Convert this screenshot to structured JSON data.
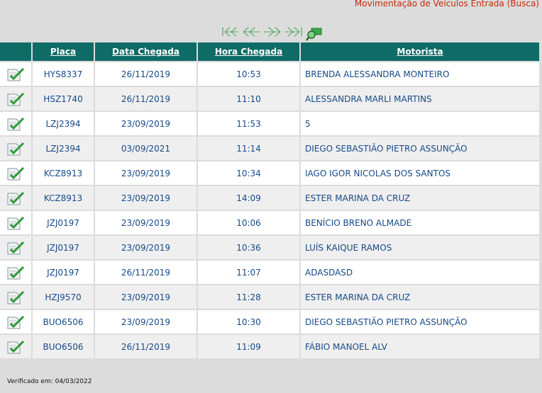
{
  "page": {
    "title": "Movimentação de Veículos Entrada (Busca)",
    "footer": "Verificado em: 04/03/2022"
  },
  "pager": {
    "buttons": [
      {
        "name": "first-page-icon"
      },
      {
        "name": "previous-page-icon"
      },
      {
        "name": "next-page-icon"
      },
      {
        "name": "last-page-icon"
      },
      {
        "name": "search-page-icon"
      }
    ],
    "color": "#2e9a3a"
  },
  "table": {
    "header_bg": "#0f6b66",
    "columns": {
      "placa": "Placa",
      "data": "Data Chegada",
      "hora": "Hora Chegada",
      "motorista": "Motorista"
    },
    "rows": [
      {
        "placa": "HYS8337",
        "data": "26/11/2019",
        "hora": "10:53",
        "motorista": "BRENDA ALESSANDRA MONTEIRO"
      },
      {
        "placa": "HSZ1740",
        "data": "26/11/2019",
        "hora": "11:10",
        "motorista": "ALESSANDRA MARLI MARTINS"
      },
      {
        "placa": "LZJ2394",
        "data": "23/09/2019",
        "hora": "11:53",
        "motorista": "5"
      },
      {
        "placa": "LZJ2394",
        "data": "03/09/2021",
        "hora": "11:14",
        "motorista": "DIEGO SEBASTIÃO PIETRO ASSUNÇÃO"
      },
      {
        "placa": "KCZ8913",
        "data": "23/09/2019",
        "hora": "10:34",
        "motorista": "IAGO IGOR NICOLAS DOS SANTOS"
      },
      {
        "placa": "KCZ8913",
        "data": "23/09/2019",
        "hora": "14:09",
        "motorista": "ESTER MARINA DA CRUZ"
      },
      {
        "placa": "JZJ0197",
        "data": "23/09/2019",
        "hora": "10:06",
        "motorista": "BENÍCIO BRENO ALMADE"
      },
      {
        "placa": "JZJ0197",
        "data": "23/09/2019",
        "hora": "10:36",
        "motorista": "LUÍS KAIQUE RAMOS"
      },
      {
        "placa": "JZJ0197",
        "data": "26/11/2019",
        "hora": "11:07",
        "motorista": "ADASDASD"
      },
      {
        "placa": "HZJ9570",
        "data": "23/09/2019",
        "hora": "11:28",
        "motorista": "ESTER MARINA DA CRUZ"
      },
      {
        "placa": "BUO6506",
        "data": "23/09/2019",
        "hora": "10:30",
        "motorista": "DIEGO SEBASTIÃO PIETRO ASSUNÇÃO"
      },
      {
        "placa": "BUO6506",
        "data": "26/11/2019",
        "hora": "11:09",
        "motorista": "FÁBIO MANOEL ALV"
      }
    ]
  }
}
